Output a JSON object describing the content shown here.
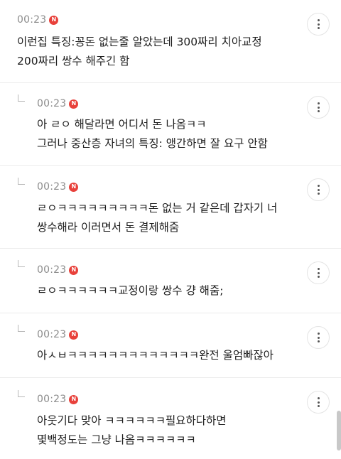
{
  "comments": [
    {
      "time": "00:23",
      "badge": "N",
      "lines": [
        "이런집 특징:꽁돈 없는줄 알았는데 300짜리 치아교정",
        "200짜리 쌍수 해주긴 함"
      ]
    },
    {
      "time": "00:23",
      "badge": "N",
      "lines": [
        "아 ㄹㅇ 해달라면 어디서 돈 나옴ㅋㅋ",
        "그러나 중산층 자녀의 특징: 앵간하면 잘 요구 안함"
      ]
    },
    {
      "time": "00:23",
      "badge": "N",
      "lines": [
        "ㄹㅇㅋㅋㅋㅋㅋㅋㅋㅋㅋ돈 없는 거 같은데 갑자기 너",
        "쌍수해라 이러면서 돈 결제해줌"
      ]
    },
    {
      "time": "00:23",
      "badge": "N",
      "lines": [
        "ㄹㅇㅋㅋㅋㅋㅋㅋ교정이랑 쌍수 걍 해줌;"
      ]
    },
    {
      "time": "00:23",
      "badge": "N",
      "lines": [
        "아ㅅㅂㅋㅋㅋㅋㅋㅋㅋㅋㅋㅋㅋㅋㅋ완전 울엄빠잖아"
      ]
    },
    {
      "time": "00:23",
      "badge": "N",
      "lines": [
        "아웃기다 맞아 ㅋㅋㅋㅋㅋㅋ필요하다하면",
        "몇백정도는 그냥 나옴ㅋㅋㅋㅋㅋㅋ"
      ]
    }
  ]
}
